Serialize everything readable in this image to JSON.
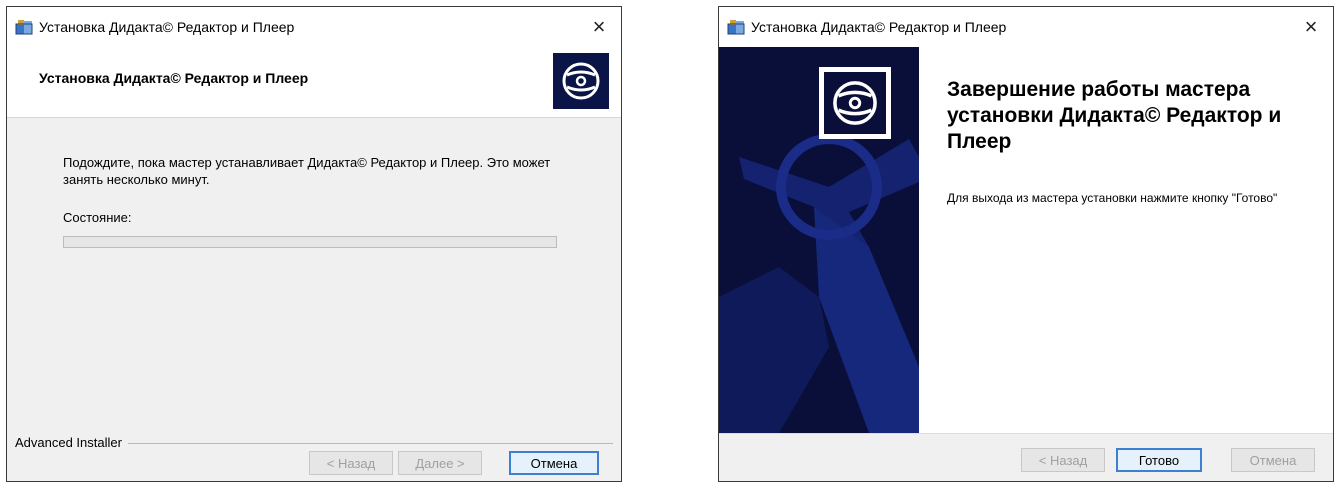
{
  "windows": [
    {
      "title": "Установка Дидакта© Редактор и Плеер",
      "close": "×",
      "header_title": "Установка Дидакта© Редактор и Плеер",
      "description": "Подождите, пока мастер устанавливает Дидакта© Редактор и Плеер. Это может занять несколько минут.",
      "state_label": "Состояние:",
      "progress": 0,
      "group_label": "Advanced Installer",
      "buttons": {
        "back": "< Назад",
        "next": "Далее >",
        "cancel": "Отмена"
      }
    },
    {
      "title": "Установка Дидакта© Редактор и Плеер",
      "close": "×",
      "heading": "Завершение работы мастера установки Дидакта© Редактор и Плеер",
      "text": "Для выхода из мастера установки нажмите кнопку \"Готово\"",
      "buttons": {
        "back": "< Назад",
        "finish": "Готово",
        "cancel": "Отмена"
      }
    }
  ],
  "colors": {
    "brand_dark": "#0a0f3a",
    "focus": "#3c7fd3",
    "progress_fill": "#06b025"
  }
}
